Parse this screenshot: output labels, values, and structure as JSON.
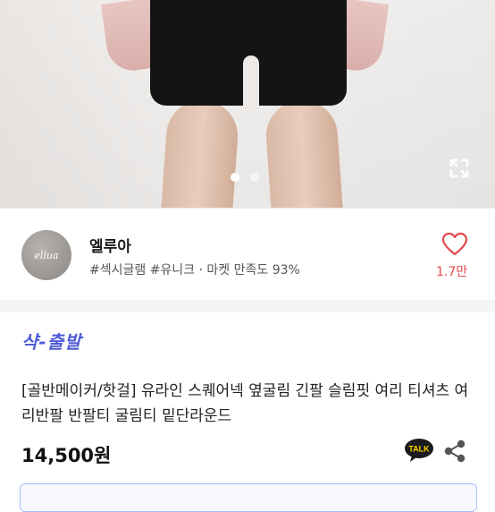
{
  "gallery": {
    "image_alt": "product-photo-black-shorts",
    "current_index": 1,
    "total": 2
  },
  "seller": {
    "avatar_text": "ellua",
    "name": "엘루아",
    "tags": "#섹시글램 #유니크 · 마켓 만족도 93%",
    "likes": "1.7만"
  },
  "product": {
    "badge": "샥-출발",
    "title": "[골반메이커/핫걸] 유라인 스퀘어넥 옆굴림 긴팔 슬림핏 여리 티셔츠 여리반팔 반팔티 굴림티 밑단라운드",
    "price": "14,500원"
  },
  "icons": {
    "expand": "expand-icon",
    "heart": "heart-icon",
    "talk": "kakao-talk-icon",
    "share": "share-icon"
  },
  "colors": {
    "accent_red": "#e5484d",
    "badge_blue": "#4f5bd5"
  }
}
